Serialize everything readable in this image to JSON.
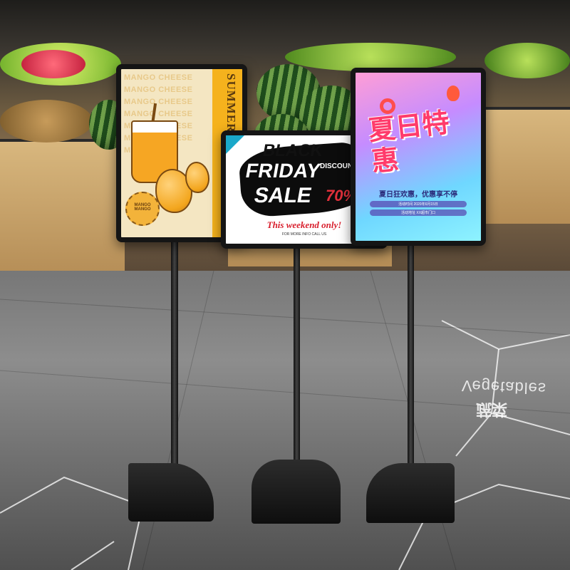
{
  "left_sign": {
    "background_text": "MANGO CHEESE MANGO CHEESE MANGO CHEESE MANGO CHEESE MANGO CHEESE MANGO CHEESE MANGO",
    "headline": "SUMMER PARTY",
    "badge_text": "MANGO MANGO"
  },
  "middle_sign": {
    "line1": "BLACK",
    "line2": "FRIDAY",
    "line3": "SALE",
    "discount": "DISCOUNT UPTO",
    "percent": "70%",
    "tagline": "This weekend only!",
    "info": "FOR MORE INFO CALL US"
  },
  "right_sign": {
    "title": "夏日特惠",
    "subtitle": "夏日狂欢惠，优惠享不停",
    "small_line1": "活动时间 2020年6月15日",
    "small_line2": "活动地址 XX超市门口"
  },
  "floor_reflection": {
    "text": "Vegetables",
    "cn_text": "蔬菜"
  },
  "colors": {
    "mango_orange": "#f5b21d",
    "sale_red": "#e0303b",
    "promo_pink": "#ff3b6b"
  }
}
